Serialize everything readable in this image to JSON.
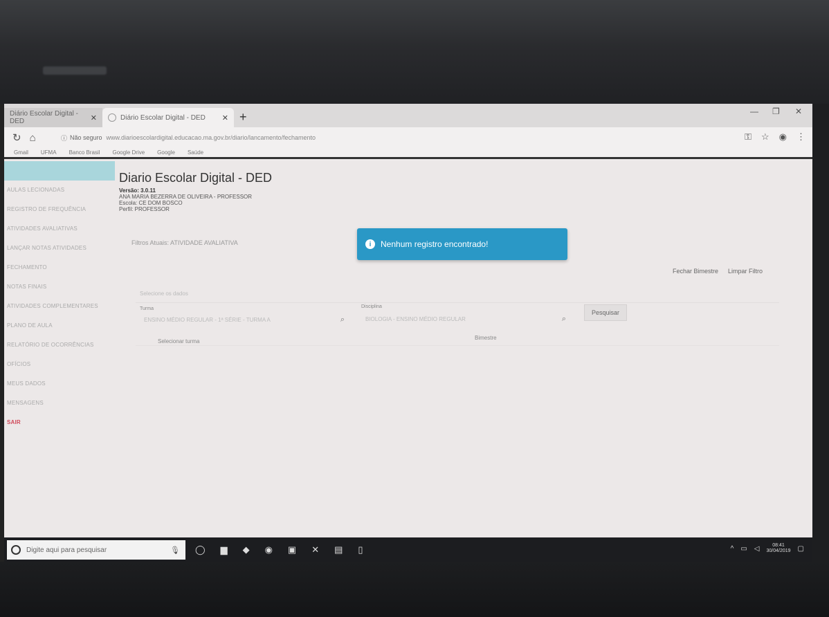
{
  "browser": {
    "tab_inactive": "Diário Escolar Digital - DED",
    "tab_active": "Diário Escolar Digital - DED",
    "address_security": "Não seguro",
    "address_url": "www.diarioescolardigital.educacao.ma.gov.br/diario/lancamento/fechamento",
    "bookmarks": [
      "Gmail",
      "UFMA",
      "Banco Brasil",
      "Google Drive",
      "Google",
      "Saúde"
    ]
  },
  "sidebar": {
    "items": [
      "AULAS LECIONADAS",
      "REGISTRO DE FREQUÊNCIA",
      "ATIVIDADES AVALIATIVAS",
      "LANÇAR NOTAS ATIVIDADES",
      "FECHAMENTO",
      "NOTAS FINAIS",
      "ATIVIDADES COMPLEMENTARES",
      "PLANO DE AULA",
      "RELATÓRIO DE OCORRÊNCIAS",
      "OFÍCIOS",
      "MEUS DADOS",
      "MENSAGENS",
      "SAIR"
    ]
  },
  "header": {
    "title": "Diario Escolar Digital - DED",
    "version": "Versão: 3.0.11",
    "user_line": "ANA MARIA BEZERRA DE OLIVEIRA - PROFESSOR",
    "school_line": "Escola: CE DOM BOSCO",
    "profile_line": "Perfil: PROFESSOR"
  },
  "filters": {
    "label": "Filtros Atuais: ATIVIDADE AVALIATIVA",
    "section_label": "Selecione os dados",
    "turma_label": "Turma",
    "turma_value": "ENSINO MÉDIO REGULAR - 1ª SÉRIE - TURMA A",
    "disciplina_label": "Disciplina",
    "disciplina_value": "BIOLOGIA - ENSINO MÉDIO REGULAR",
    "pesquisar": "Pesquisar",
    "selecionar": "Selecionar turma",
    "bimestre": "Bimestre"
  },
  "toast": {
    "message": "Nenhum registro encontrado!"
  },
  "actions": {
    "fechar": "Fechar Bimestre",
    "limpar": "Limpar Filtro"
  },
  "taskbar": {
    "search_placeholder": "Digite aqui para pesquisar",
    "time": "08:41",
    "date": "30/04/2019"
  }
}
